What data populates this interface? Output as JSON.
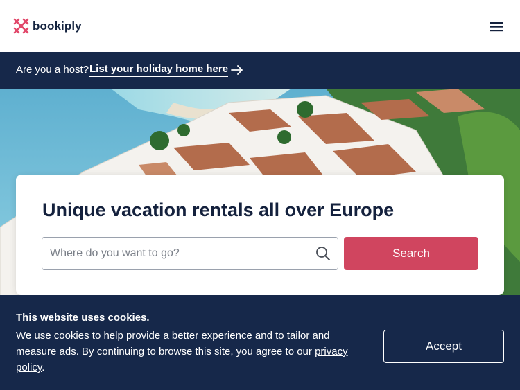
{
  "brand": {
    "name": "bookiply",
    "accent": "#d0455f",
    "navy": "#16284a"
  },
  "header": {
    "menu_icon": "hamburger-menu-icon"
  },
  "hostbar": {
    "question": "Are you a host?",
    "link_label": "List your holiday home here",
    "arrow_icon": "arrow-right-icon"
  },
  "hero": {
    "image": "coastal-village-aerial-photo",
    "title": "Unique vacation rentals all over Europe"
  },
  "search": {
    "placeholder": "Where do you want to go?",
    "value": "",
    "icon": "search-icon",
    "button_label": "Search"
  },
  "cookie": {
    "title": "This website uses cookies.",
    "text_before_link": "We use cookies to help provide a better experience and to tailor and measure ads. By continuing to browse this site, you agree to our ",
    "link_label": "privacy policy",
    "text_after_link": ".",
    "accept_label": "Accept"
  }
}
